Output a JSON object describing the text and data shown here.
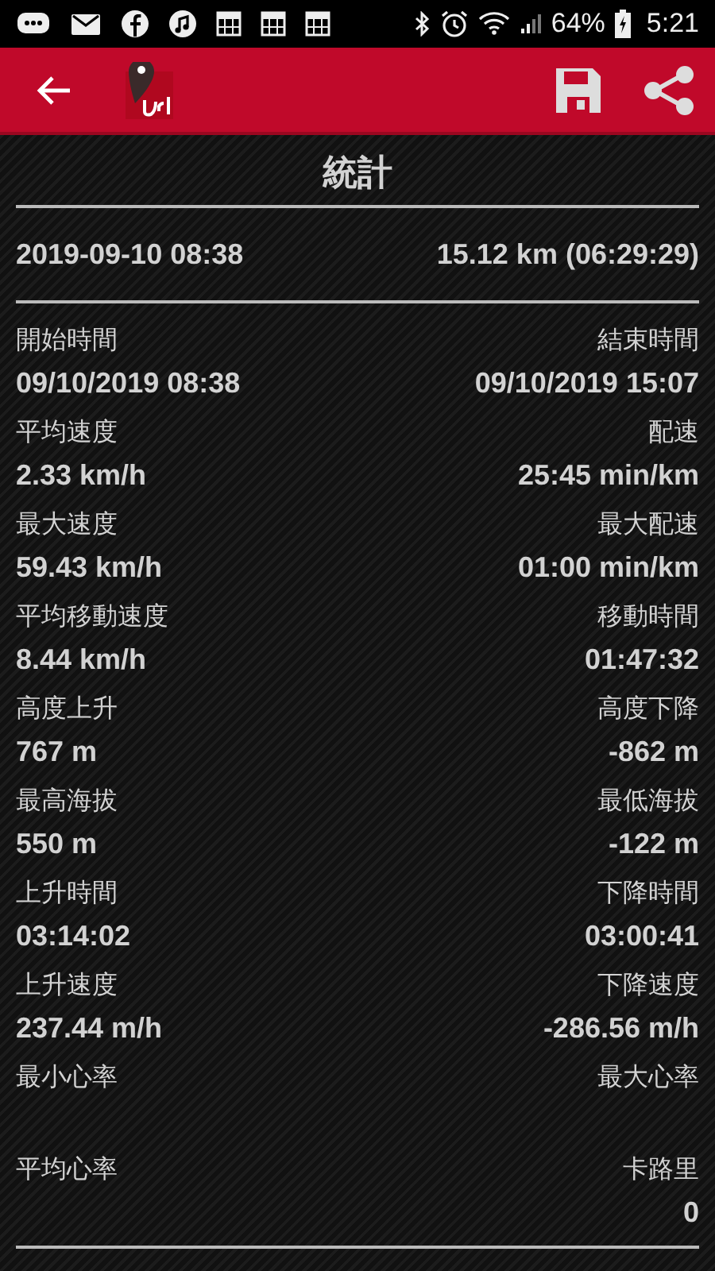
{
  "status_bar": {
    "battery": "64%",
    "time": "5:21"
  },
  "section_title": "統計",
  "summary": {
    "start": "2019-09-10 08:38",
    "distance": "15.12 km (06:29:29)"
  },
  "stats": [
    {
      "left": {
        "label": "開始時間",
        "value": "09/10/2019 08:38"
      },
      "right": {
        "label": "結束時間",
        "value": "09/10/2019 15:07"
      }
    },
    {
      "left": {
        "label": "平均速度",
        "value": "2.33 km/h"
      },
      "right": {
        "label": "配速",
        "value": "25:45 min/km"
      }
    },
    {
      "left": {
        "label": "最大速度",
        "value": "59.43 km/h"
      },
      "right": {
        "label": "最大配速",
        "value": "01:00 min/km"
      }
    },
    {
      "left": {
        "label": "平均移動速度",
        "value": "8.44 km/h"
      },
      "right": {
        "label": "移動時間",
        "value": "01:47:32"
      }
    },
    {
      "left": {
        "label": "高度上升",
        "value": "767 m"
      },
      "right": {
        "label": "高度下降",
        "value": "-862 m"
      }
    },
    {
      "left": {
        "label": "最高海拔",
        "value": "550 m"
      },
      "right": {
        "label": "最低海拔",
        "value": "-122 m"
      }
    },
    {
      "left": {
        "label": "上升時間",
        "value": "03:14:02"
      },
      "right": {
        "label": "下降時間",
        "value": "03:00:41"
      }
    },
    {
      "left": {
        "label": "上升速度",
        "value": "237.44 m/h"
      },
      "right": {
        "label": "下降速度",
        "value": "-286.56 m/h"
      }
    },
    {
      "left": {
        "label": "最小心率"
      },
      "right": {
        "label": "最大心率"
      }
    },
    {
      "left": {
        "label": "平均心率"
      },
      "right": {
        "label": "卡路里",
        "value": "0"
      }
    }
  ]
}
